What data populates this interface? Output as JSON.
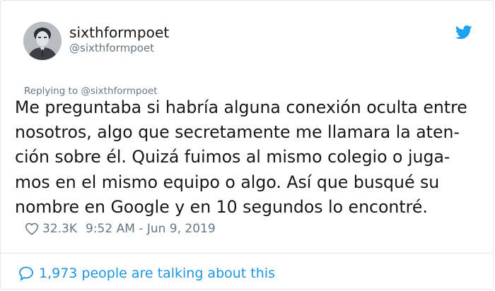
{
  "user": {
    "name": "sixthformpoet",
    "handle": "@sixthformpoet"
  },
  "tweet": {
    "replying_to": "Replying to @sixthformpoet",
    "text": "Me preguntaba si habría alguna conexión oculta entre\nnosotros, algo que secretamente me llamara la aten-\nción sobre él. Quizá fuimos al mismo colegio o juga-\nmos en el mismo equipo o algo. Así que busqué su\nnombre en Google y en 10 segundos lo encontré.",
    "likes": "32.3K",
    "timestamp": "9:52 AM - Jun 9, 2019"
  },
  "footer": {
    "talking_text": "1,973 people are talking about this"
  },
  "icons": {
    "brand": "twitter-bird-icon",
    "like": "heart-icon",
    "conversation": "speech-bubble-icon"
  },
  "colors": {
    "twitter_blue": "#1da1f2",
    "link_blue": "#1b95e0",
    "muted_gray": "#657786",
    "text": "#14171a",
    "border": "#e1e8ed"
  }
}
